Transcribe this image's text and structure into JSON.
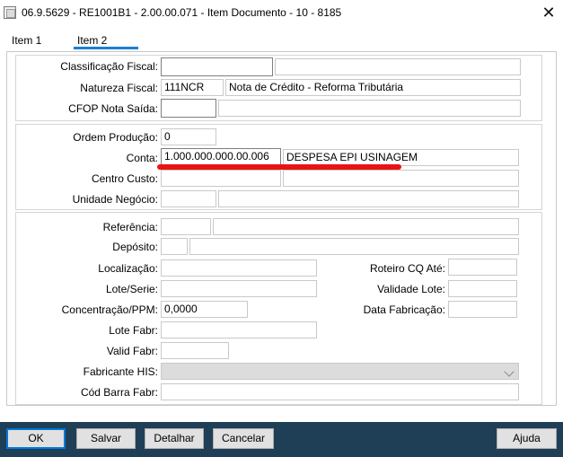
{
  "window": {
    "title": "06.9.5629 - RE1001B1 - 2.00.00.071 - Item Documento - 10 - 8185",
    "close_icon": "close-icon"
  },
  "tabs": [
    {
      "label": "Item 1"
    },
    {
      "label": "Item 2",
      "active": true
    }
  ],
  "group1": {
    "classificacao_fiscal": {
      "label": "Classificação Fiscal:",
      "value": "",
      "desc": ""
    },
    "natureza_fiscal": {
      "label": "Natureza Fiscal:",
      "value": "111NCR",
      "desc": "Nota de Crédito - Reforma Tributária"
    },
    "cfop_nota_saida": {
      "label": "CFOP Nota Saída:",
      "value": "",
      "desc": ""
    }
  },
  "group2": {
    "ordem_producao": {
      "label": "Ordem Produção:",
      "value": "0"
    },
    "conta": {
      "label": "Conta:",
      "value": "1.000.000.000.00.006",
      "desc": "DESPESA EPI USINAGEM"
    },
    "centro_custo": {
      "label": "Centro Custo:",
      "value": "",
      "desc": ""
    },
    "unidade_negocio": {
      "label": "Unidade Negócio:",
      "value": "",
      "desc": ""
    }
  },
  "group3": {
    "referencia": {
      "label": "Referência:",
      "value": "",
      "desc": ""
    },
    "deposito": {
      "label": "Depósito:",
      "value": "",
      "desc": ""
    },
    "localizacao": {
      "label": "Localização:",
      "value": ""
    },
    "lote_serie": {
      "label": "Lote/Serie:",
      "value": ""
    },
    "concentracao_ppm": {
      "label": "Concentração/PPM:",
      "value": "0,0000"
    },
    "lote_fabr": {
      "label": "Lote Fabr:",
      "value": ""
    },
    "valid_fabr": {
      "label": "Valid Fabr:",
      "value": ""
    },
    "fabricante_his": {
      "label": "Fabricante HIS:",
      "value": ""
    },
    "cod_barra_fabr": {
      "label": "Cód Barra Fabr:",
      "value": ""
    },
    "roteiro_cq_ate": {
      "label": "Roteiro CQ Até:",
      "value": ""
    },
    "validade_lote": {
      "label": "Validade Lote:",
      "value": ""
    },
    "data_fabricacao": {
      "label": "Data Fabricação:",
      "value": ""
    }
  },
  "buttons": {
    "ok": "OK",
    "salvar": "Salvar",
    "detalhar": "Detalhar",
    "cancelar": "Cancelar",
    "ajuda": "Ajuda"
  },
  "colors": {
    "bottombar": "#1f3f57",
    "tab_active": "#1a7fd6",
    "highlight_mark": "#e81414"
  }
}
